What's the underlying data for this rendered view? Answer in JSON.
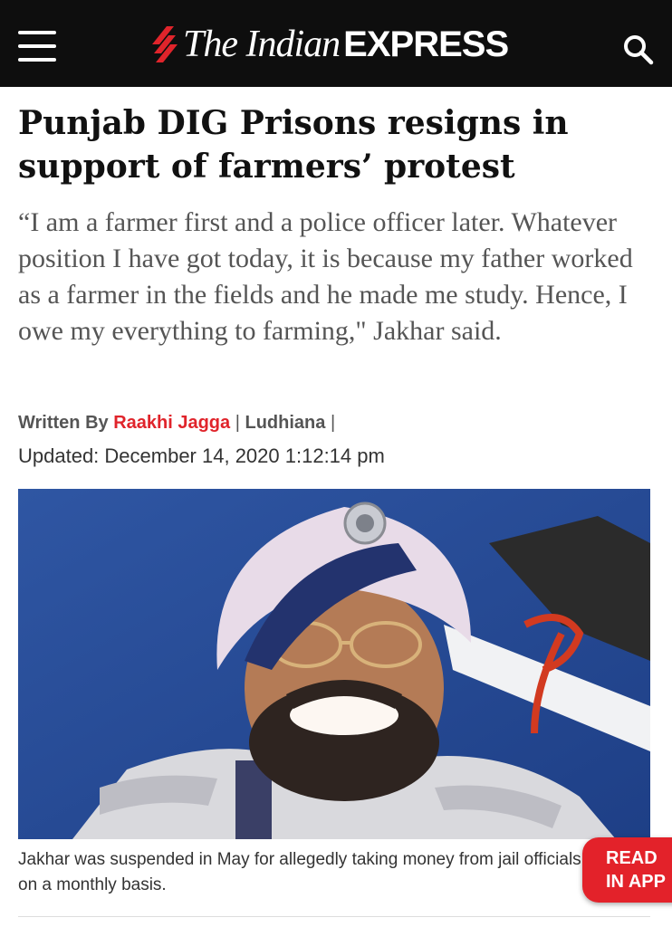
{
  "header": {
    "menu_icon": "hamburger-menu-icon",
    "logo": {
      "the": "The Indian",
      "express": "EXPRESS",
      "accent": "#e0242b"
    },
    "search_icon": "search-icon",
    "background": "#0e0e0e"
  },
  "article": {
    "headline": "Punjab DIG Prisons resigns in support of farmers’ protest",
    "standfirst": "“I am a farmer first and a police officer later. Whatever position I have got today, it is because my father worked as a farmer in the fields and he made me study. Hence, I owe my everything to farming,\" Jakhar said.",
    "byline": {
      "prefix": "Written By",
      "author": "Raakhi Jagga",
      "separator1": "|",
      "location": "Ludhiana",
      "separator2": "|"
    },
    "updated": "Updated: December 14, 2020 1:12:14 pm",
    "image_caption": "Jakhar was suspended in May for allegedly taking money from jail officials on a monthly basis."
  },
  "floating_button": {
    "line1": "READ",
    "line2": "IN APP",
    "color": "#e3222a"
  }
}
